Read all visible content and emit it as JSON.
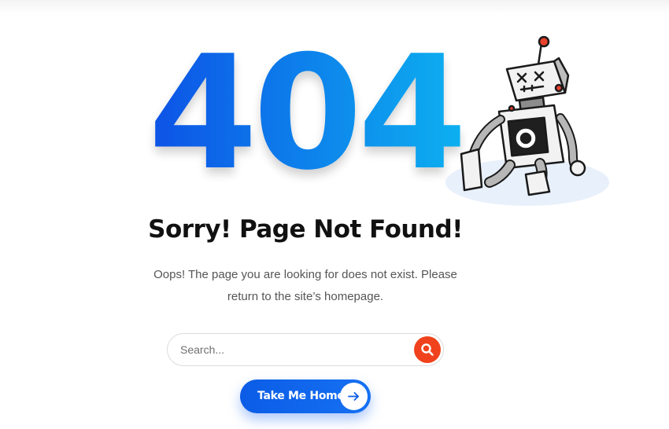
{
  "hero": {
    "error_code": "404",
    "illustration": "broken-robot-icon"
  },
  "main": {
    "title": "Sorry! Page Not Found!",
    "message": "Oops! The page you are looking for does not exist. Please return to the site’s homepage."
  },
  "search": {
    "placeholder": "Search...",
    "value": "",
    "button_icon": "search-icon"
  },
  "home_button": {
    "label": "Take Me Home",
    "icon": "arrow-right-icon"
  },
  "colors": {
    "gradient_start": "#0a52e6",
    "gradient_end": "#08b0f0",
    "search_button": "#f0431d",
    "button_blue": "#0b5ce6",
    "title": "#111111",
    "body_text": "#555555"
  }
}
